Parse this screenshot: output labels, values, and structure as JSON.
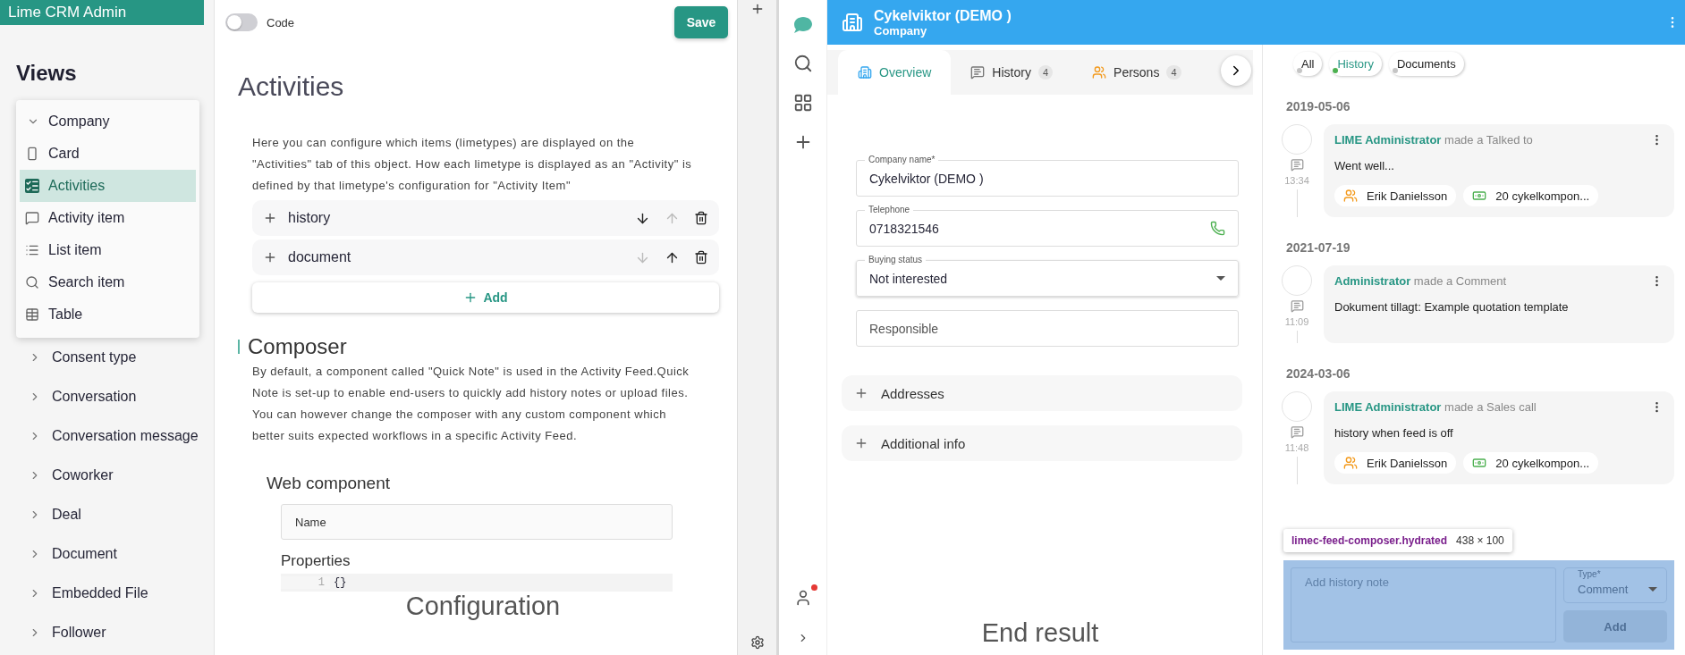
{
  "admin": {
    "title": "Lime CRM Admin",
    "heading": "Views",
    "tree": [
      {
        "label": "Company",
        "expanded": true,
        "children": [
          {
            "label": "Card",
            "kind": "card",
            "selected": false
          },
          {
            "label": "Activities",
            "kind": "activities",
            "selected": true
          },
          {
            "label": "Activity item",
            "kind": "comment",
            "selected": false
          },
          {
            "label": "List item",
            "kind": "list",
            "selected": false
          },
          {
            "label": "Search item",
            "kind": "search",
            "selected": false
          },
          {
            "label": "Table",
            "kind": "table",
            "selected": false
          }
        ]
      },
      {
        "label": "Consent type",
        "expanded": false
      },
      {
        "label": "Conversation",
        "expanded": false
      },
      {
        "label": "Conversation message",
        "expanded": false
      },
      {
        "label": "Coworker",
        "expanded": false
      },
      {
        "label": "Deal",
        "expanded": false
      },
      {
        "label": "Document",
        "expanded": false
      },
      {
        "label": "Embedded File",
        "expanded": false
      },
      {
        "label": "Follower",
        "expanded": false
      }
    ]
  },
  "editor": {
    "code_toggle": {
      "label": "Code",
      "on": false
    },
    "save": "Save",
    "title": "Activities",
    "description": "Here you can configure which items (limetypes) are displayed on the \"Activities\" tab of this object. How each limetype is displayed as an \"Activity\" is defined by that limetype's configuration for \"Activity Item\"",
    "limetypes": [
      {
        "label": "history",
        "down_disabled": false,
        "up_disabled": true
      },
      {
        "label": "document",
        "down_disabled": true,
        "up_disabled": false
      }
    ],
    "add": "Add",
    "composer": {
      "title": "Composer",
      "description": "By default, a component called \"Quick Note\" is used in the Activity Feed.Quick Note is set-up to enable end-users to quickly add history notes or upload files. You can however change the composer with any custom component which better suits expected workflows in a specific Activity Feed.",
      "web_component": "Web component",
      "name_placeholder": "Name",
      "properties": "Properties",
      "code_lines": [
        {
          "number": "1",
          "text": "{}"
        }
      ]
    },
    "caption": "Configuration"
  },
  "app": {
    "has_notification": true,
    "title": "Cykelviktor (DEMO )",
    "subtitle": "Company",
    "tabs": [
      {
        "label": "Overview",
        "kind": "building",
        "selected": true
      },
      {
        "label": "History",
        "kind": "comment",
        "count": "4",
        "selected": false
      },
      {
        "label": "Persons",
        "kind": "persons",
        "count": "4",
        "selected": false
      }
    ],
    "fields": [
      {
        "kind": "text",
        "label": "Company name*",
        "value": "Cykelviktor (DEMO )"
      },
      {
        "kind": "phone",
        "label": "Telephone",
        "value": "0718321546"
      },
      {
        "kind": "select",
        "label": "Buying status",
        "value": "Not interested"
      },
      {
        "kind": "empty",
        "placeholder": "Responsible"
      }
    ],
    "sections": [
      {
        "label": "Addresses",
        "expanded": false
      },
      {
        "label": "Additional info",
        "expanded": false
      }
    ],
    "caption": "End result",
    "feed": {
      "filters": [
        {
          "label": "All",
          "selected": false
        },
        {
          "label": "History",
          "selected": true
        },
        {
          "label": "Documents",
          "selected": false
        }
      ],
      "groups": [
        {
          "date": "2019-05-06",
          "items": [
            {
              "author": "LIME Administrator",
              "action": "made a Talked to",
              "time": "13:34",
              "body": "Went well...",
              "tags": [
                {
                  "kind": "person",
                  "label": "Erik Danielsson"
                },
                {
                  "kind": "deal",
                  "label": "20 cykelkompon..."
                }
              ]
            }
          ]
        },
        {
          "date": "2021-07-19",
          "items": [
            {
              "author": "Administrator",
              "action": "made a Comment",
              "time": "11:09",
              "body": "Dokument tillagt: Example quotation template"
            }
          ]
        },
        {
          "date": "2024-03-06",
          "items": [
            {
              "author": "LIME Administrator",
              "action": "made a Sales call",
              "time": "11:48",
              "body": "history when feed is off",
              "tags": [
                {
                  "kind": "person",
                  "label": "Erik Danielsson"
                },
                {
                  "kind": "deal",
                  "label": "20 cykelkompon..."
                }
              ]
            }
          ]
        }
      ],
      "tooltip": {
        "element": "limec-feed-composer.hydrated",
        "size": "438 × 100"
      },
      "composer": {
        "placeholder": "Add history note",
        "type_label": "Type*",
        "type_value": "Comment",
        "add": "Add"
      }
    }
  }
}
